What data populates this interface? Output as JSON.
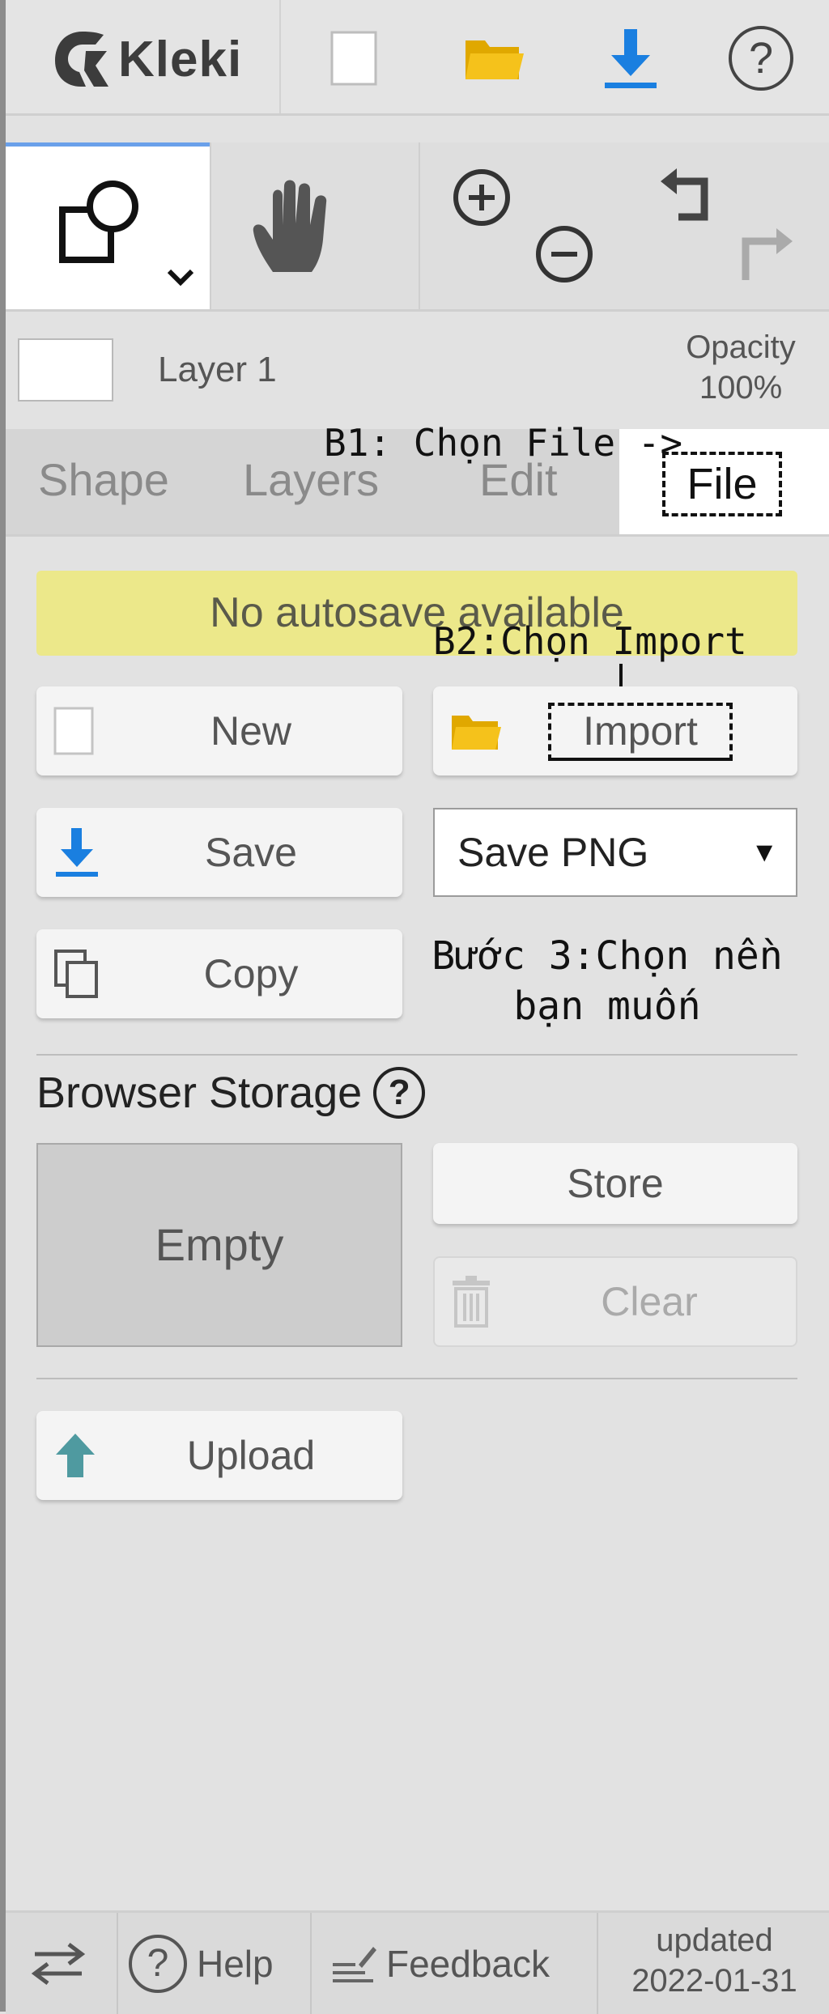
{
  "app": {
    "name": "Kleki"
  },
  "toolbar": {
    "new_icon": "new-file-icon",
    "open_icon": "folder-icon",
    "download_icon": "download-icon",
    "help_icon": "help-icon"
  },
  "tools": {
    "shape_icon": "shape-tool-icon",
    "hand_icon": "hand-tool-icon",
    "zoom_in": "zoom-in-icon",
    "zoom_out": "zoom-out-icon",
    "undo": "undo-icon",
    "redo": "redo-icon"
  },
  "layer": {
    "name": "Layer 1",
    "opacity_label": "Opacity",
    "opacity_value": "100%"
  },
  "tabs": [
    {
      "label": "Shape",
      "active": false
    },
    {
      "label": "Layers",
      "active": false
    },
    {
      "label": "Edit",
      "active": false
    },
    {
      "label": "File",
      "active": true
    }
  ],
  "annotations": {
    "step1": "B1: Chọn File ->",
    "step2": "B2:Chọn Import",
    "step3_line1": "Bước 3:Chọn nền",
    "step3_line2": "bạn muốn"
  },
  "file_panel": {
    "notice": "No autosave available",
    "new_label": "New",
    "import_label": "Import",
    "save_label": "Save",
    "save_format": "Save PNG",
    "copy_label": "Copy",
    "storage_title": "Browser Storage",
    "storage_help": "?",
    "storage_state": "Empty",
    "store_label": "Store",
    "clear_label": "Clear",
    "upload_label": "Upload"
  },
  "footer": {
    "swap_icon": "swap-arrows-icon",
    "help_label": "Help",
    "feedback_label": "Feedback",
    "updated_label": "updated",
    "updated_date": "2022-01-31"
  },
  "colors": {
    "accent_blue": "#1a7fe0",
    "folder_yellow": "#f5c21b",
    "notice_bg": "#ece88a",
    "upload_teal": "#4f9aa0"
  }
}
